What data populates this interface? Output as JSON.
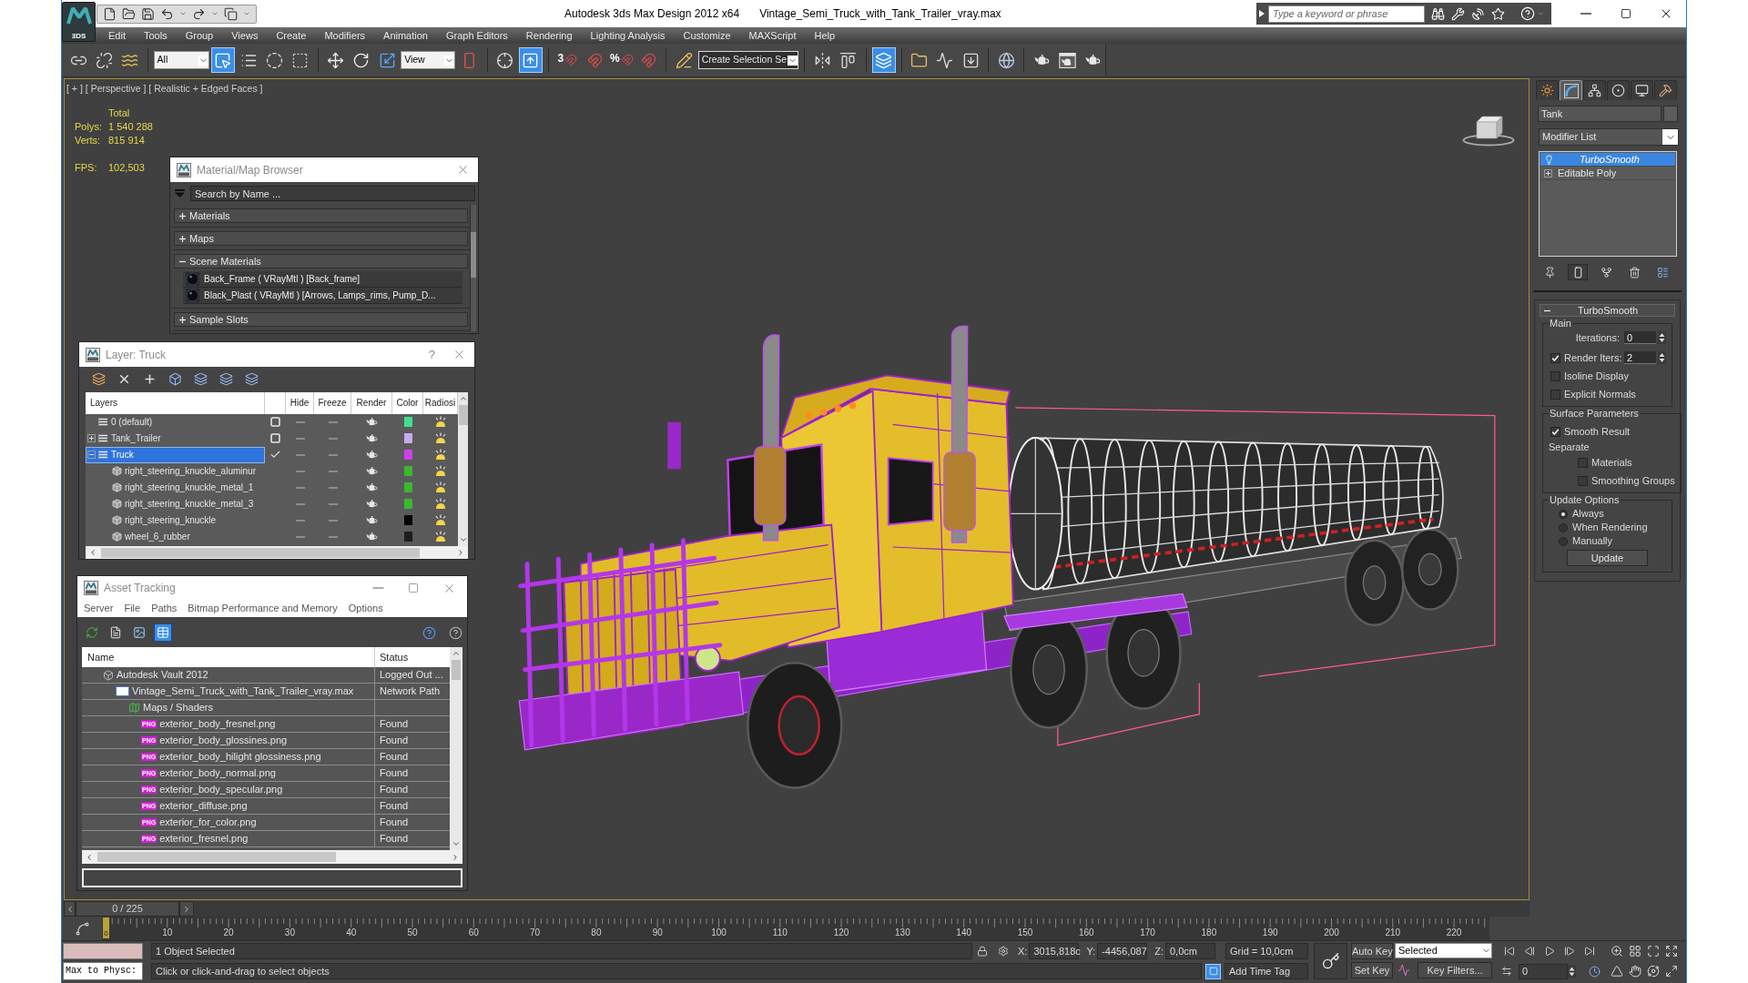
{
  "title_bar": {
    "logo_caption": "3DS",
    "app_title": "Autodesk 3ds Max Design 2012 x64",
    "file_name": "Vintage_Semi_Truck_with_Tank_Trailer_vray.max",
    "search": {
      "placeholder": "Type a keyword or phrase"
    }
  },
  "menu_bar": [
    "Edit",
    "Tools",
    "Group",
    "Views",
    "Create",
    "Modifiers",
    "Animation",
    "Graph Editors",
    "Rendering",
    "Lighting Analysis",
    "Customize",
    "MAXScript",
    "Help"
  ],
  "main_toolbar": [
    {
      "kind": "button",
      "active": false
    },
    {
      "kind": "button",
      "active": false
    },
    {
      "kind": "button",
      "active": false
    },
    {
      "kind": "separator"
    },
    {
      "kind": "dropdown",
      "value": "All"
    },
    {
      "kind": "button",
      "active": true
    },
    {
      "kind": "button",
      "active": false
    },
    {
      "kind": "button",
      "active": false
    },
    {
      "kind": "button",
      "active": false
    },
    {
      "kind": "separator"
    },
    {
      "kind": "button",
      "active": false
    },
    {
      "kind": "button",
      "active": false
    },
    {
      "kind": "button",
      "active": false
    },
    {
      "kind": "dropdown",
      "value": "View"
    },
    {
      "kind": "button",
      "active": false
    },
    {
      "kind": "separator"
    },
    {
      "kind": "button",
      "active": false
    },
    {
      "kind": "button",
      "active": true
    },
    {
      "kind": "separator"
    },
    {
      "kind": "button",
      "active": false,
      "glyph": "3"
    },
    {
      "kind": "button",
      "active": false
    },
    {
      "kind": "button",
      "active": false,
      "glyph": "%"
    },
    {
      "kind": "button",
      "active": false
    },
    {
      "kind": "separator"
    },
    {
      "kind": "button",
      "active": false
    },
    {
      "kind": "dropdown",
      "value": "Create Selection Se"
    },
    {
      "kind": "separator"
    },
    {
      "kind": "button",
      "active": false
    },
    {
      "kind": "button",
      "active": false
    },
    {
      "kind": "separator"
    },
    {
      "kind": "button",
      "active": true
    },
    {
      "kind": "separator"
    },
    {
      "kind": "button",
      "active": false
    },
    {
      "kind": "button",
      "active": false
    },
    {
      "kind": "button",
      "active": false
    },
    {
      "kind": "separator"
    },
    {
      "kind": "button",
      "active": false
    },
    {
      "kind": "separator"
    },
    {
      "kind": "button",
      "active": false
    },
    {
      "kind": "button",
      "active": false
    },
    {
      "kind": "button",
      "active": false
    }
  ],
  "viewport": {
    "labels": [
      "[ + ]",
      "[ Perspective ]",
      "[ Realistic + Edged Faces ]"
    ],
    "stats": {
      "header": "Total",
      "rows": [
        {
          "label": "Polys:",
          "value": "1 540 288"
        },
        {
          "label": "Verts:",
          "value": "815 914"
        }
      ],
      "fps": {
        "label": "FPS:",
        "value": "102,503"
      }
    }
  },
  "material_browser": {
    "title": "Material/Map Browser",
    "search": {
      "placeholder": "Search by Name ..."
    },
    "groups": [
      {
        "label": "Materials",
        "expanded": false
      },
      {
        "label": "Maps",
        "expanded": false
      },
      {
        "label": "Scene Materials",
        "expanded": true,
        "items": [
          "Back_Frame ( VRayMtl ) [Back_frame]",
          "Black_Plast ( VRayMtl ) [Arrows, Lamps_rims, Pump_D..."
        ]
      },
      {
        "label": "Sample Slots",
        "expanded": false
      }
    ]
  },
  "layer_manager": {
    "title": "Layer: Truck",
    "help": "?",
    "columns": [
      "Layers",
      "Hide",
      "Freeze",
      "Render",
      "Color",
      "Radiosi"
    ],
    "layers": [
      {
        "name": "0 (default)",
        "selected": false,
        "current": false,
        "hidden": false,
        "frozen": false,
        "renderable": true,
        "color": "#40e090"
      },
      {
        "name": "Tank_Trailer",
        "selected": false,
        "current": false,
        "expanded": false,
        "hidden": false,
        "frozen": false,
        "renderable": true,
        "color": "#c8a8f0"
      },
      {
        "name": "Truck",
        "selected": true,
        "current": true,
        "expanded": true,
        "hidden": false,
        "frozen": false,
        "renderable": true,
        "color": "#d040e8",
        "children": [
          {
            "name": "right_steering_knuckle_aluminur",
            "selected": false,
            "hidden": false,
            "frozen": false,
            "renderable": true,
            "color": "#3cb82c"
          },
          {
            "name": "right_steering_knuckle_metal_1",
            "selected": false,
            "hidden": false,
            "frozen": false,
            "renderable": true,
            "color": "#3cb82c"
          },
          {
            "name": "right_steering_knuckle_metal_3",
            "selected": false,
            "hidden": false,
            "frozen": false,
            "renderable": true,
            "color": "#3cb82c"
          },
          {
            "name": "right_steering_knuckle",
            "selected": false,
            "hidden": false,
            "frozen": false,
            "renderable": true,
            "color": "#050505"
          },
          {
            "name": "wheel_6_rubber",
            "selected": false,
            "hidden": false,
            "frozen": false,
            "renderable": true,
            "color": "#1c1c1c"
          }
        ]
      }
    ]
  },
  "asset_tracking": {
    "title": "Asset Tracking",
    "menu": [
      "Server",
      "File",
      "Paths",
      "Bitmap Performance and Memory",
      "Options"
    ],
    "toolbar": [
      {
        "active": false
      },
      {
        "active": false
      },
      {
        "active": false
      },
      {
        "active": true
      }
    ],
    "columns": [
      "Name",
      "Status"
    ],
    "tree": [
      {
        "kind": "vault",
        "name": "Autodesk Vault 2012",
        "status": "Logged Out ...",
        "selected": false,
        "children": [
          {
            "kind": "scene_file",
            "name": "Vintage_Semi_Truck_with_Tank_Trailer_vray.max",
            "status": "Network Path",
            "selected": false,
            "children": [
              {
                "kind": "folder",
                "name": "Maps / Shaders",
                "selected": false,
                "children": [
                  {
                    "kind": "bitmap",
                    "badge": "PNG",
                    "name": "exterior_body_fresnel.png",
                    "status": "Found",
                    "selected": false
                  },
                  {
                    "kind": "bitmap",
                    "badge": "PNG",
                    "name": "exterior_body_glossines.png",
                    "status": "Found",
                    "selected": false
                  },
                  {
                    "kind": "bitmap",
                    "badge": "PNG",
                    "name": "exterior_body_hilight glossiness.png",
                    "status": "Found",
                    "selected": false
                  },
                  {
                    "kind": "bitmap",
                    "badge": "PNG",
                    "name": "exterior_body_normal.png",
                    "status": "Found",
                    "selected": false
                  },
                  {
                    "kind": "bitmap",
                    "badge": "PNG",
                    "name": "exterior_body_specular.png",
                    "status": "Found",
                    "selected": false
                  },
                  {
                    "kind": "bitmap",
                    "badge": "PNG",
                    "name": "exterior_diffuse.png",
                    "status": "Found",
                    "selected": false
                  },
                  {
                    "kind": "bitmap",
                    "badge": "PNG",
                    "name": "exterior_for_color.png",
                    "status": "Found",
                    "selected": false
                  },
                  {
                    "kind": "bitmap",
                    "badge": "PNG",
                    "name": "exterior_fresnel.png",
                    "status": "Found",
                    "selected": false
                  }
                ]
              }
            ]
          }
        ]
      }
    ]
  },
  "command_panel": {
    "tabs": [
      {
        "selected": false
      },
      {
        "selected": true
      },
      {
        "selected": false
      },
      {
        "selected": false
      },
      {
        "selected": false
      },
      {
        "selected": false
      }
    ],
    "object_name": "Tank",
    "modifier_list": "Modifier List",
    "stack": [
      {
        "kind": "modifier",
        "name": "TurboSmooth",
        "selected": true
      },
      {
        "kind": "base_object",
        "name": "Editable Poly",
        "selected": false,
        "expanded": false
      }
    ],
    "stack_buttons": [
      {
        "active": false
      },
      {
        "active": true
      },
      {
        "active": false
      },
      {
        "active": false
      },
      {
        "active": false
      }
    ],
    "rollout": {
      "title": "TurboSmooth",
      "expanded": true,
      "groups": [
        {
          "title": "Main",
          "controls": [
            {
              "kind": "spinner",
              "label": "Iterations:",
              "value": "0"
            },
            {
              "kind": "checkbox_spinner",
              "label": "Render Iters:",
              "checked": true,
              "value": "2"
            },
            {
              "kind": "checkbox",
              "label": "Isoline Display",
              "checked": false
            },
            {
              "kind": "checkbox",
              "label": "Explicit Normals",
              "checked": false
            }
          ]
        },
        {
          "title": "Surface Parameters",
          "controls": [
            {
              "kind": "checkbox",
              "label": "Smooth Result",
              "checked": true
            },
            {
              "kind": "label",
              "label": "Separate",
              "children": [
                {
                  "kind": "checkbox",
                  "label": "Materials",
                  "checked": false
                },
                {
                  "kind": "checkbox",
                  "label": "Smoothing Groups",
                  "checked": false
                }
              ]
            }
          ]
        },
        {
          "title": "Update Options",
          "controls": [
            {
              "kind": "radio",
              "label": "Always",
              "selected": true
            },
            {
              "kind": "radio",
              "label": "When Rendering",
              "selected": false
            },
            {
              "kind": "radio",
              "label": "Manually",
              "selected": false
            },
            {
              "kind": "button",
              "label": "Update"
            }
          ]
        }
      ]
    }
  },
  "timeline": {
    "slider": {
      "label": "0 / 225",
      "level": 0
    },
    "ruler_labels": [
      "10",
      "20",
      "30",
      "40",
      "50",
      "60",
      "70",
      "80",
      "90",
      "100",
      "110",
      "120",
      "130",
      "140",
      "150",
      "160",
      "170",
      "180",
      "190",
      "200",
      "210",
      "220"
    ],
    "current_frame": "0"
  },
  "status_bar": {
    "listener": "Max to Physc:",
    "selection_info": "1 Object Selected",
    "prompt": "Click or click-and-drag to select objects",
    "coordinates": [
      {
        "axis": "X:",
        "value": "3015,818c"
      },
      {
        "axis": "Y:",
        "value": "-4456,087"
      },
      {
        "axis": "Z:",
        "value": "0,0cm"
      }
    ],
    "grid": "Grid = 10,0cm",
    "add_time_tag": "Add Time Tag",
    "auto_key": {
      "label": "Auto Key",
      "active": false
    },
    "set_key": "Set Key",
    "key_set": "Selected",
    "key_filters": "Key Filters...",
    "frame": "0"
  }
}
